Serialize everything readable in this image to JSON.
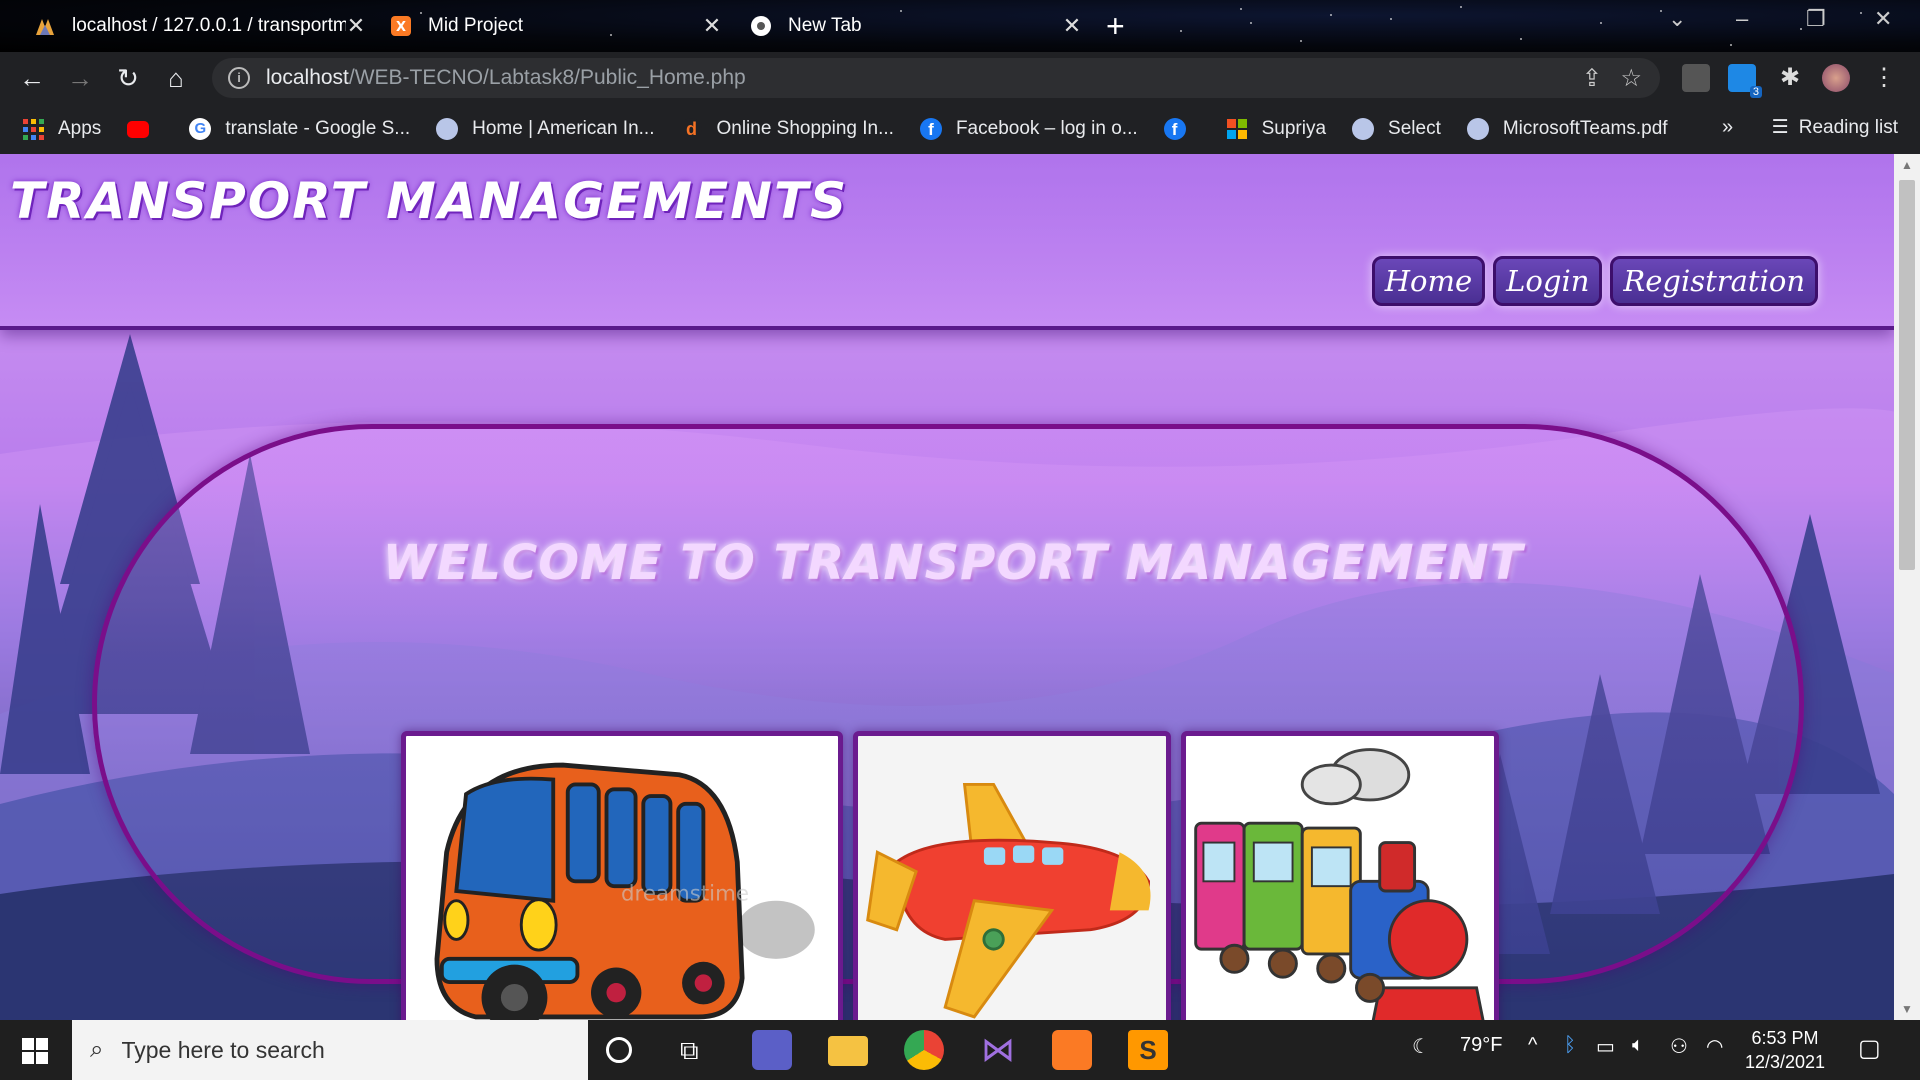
{
  "browser": {
    "tabs": [
      {
        "title": "localhost / 127.0.0.1 / transportm",
        "icon": "phpmyadmin-icon"
      },
      {
        "title": "Mid Project",
        "icon": "xampp-icon"
      },
      {
        "title": "New Tab",
        "icon": "chrome-icon"
      }
    ],
    "url_host": "localhost",
    "url_path": "/WEB-TECNO/Labtask8/Public_Home.php",
    "bookmarks": [
      {
        "label": "Apps",
        "icon": "apps-grid-icon"
      },
      {
        "label": "",
        "icon": "youtube-icon"
      },
      {
        "label": "translate - Google S...",
        "icon": "google-icon"
      },
      {
        "label": "Home | American In...",
        "icon": "site-icon"
      },
      {
        "label": "Online Shopping In...",
        "icon": "daraz-icon"
      },
      {
        "label": "Facebook – log in o...",
        "icon": "facebook-icon"
      },
      {
        "label": "",
        "icon": "facebook-icon"
      },
      {
        "label": "Supriya",
        "icon": "microsoft-icon"
      },
      {
        "label": "Select",
        "icon": "site-icon"
      },
      {
        "label": "MicrosoftTeams.pdf",
        "icon": "site-icon"
      }
    ],
    "more": "»",
    "reading_list": "Reading list",
    "extension_badge": "3"
  },
  "site": {
    "brand": "TRANSPORT MANAGEMENTS",
    "nav": [
      "Home",
      "Login",
      "Registration"
    ],
    "welcome": "WELCOME TO TRANSPORT MANAGEMENT",
    "cards": [
      "bus-image",
      "airplane-image",
      "train-image"
    ],
    "watermark": "dreamstime"
  },
  "taskbar": {
    "search_placeholder": "Type here to search",
    "weather": "79°F",
    "time": "6:53 PM",
    "date": "12/3/2021"
  }
}
